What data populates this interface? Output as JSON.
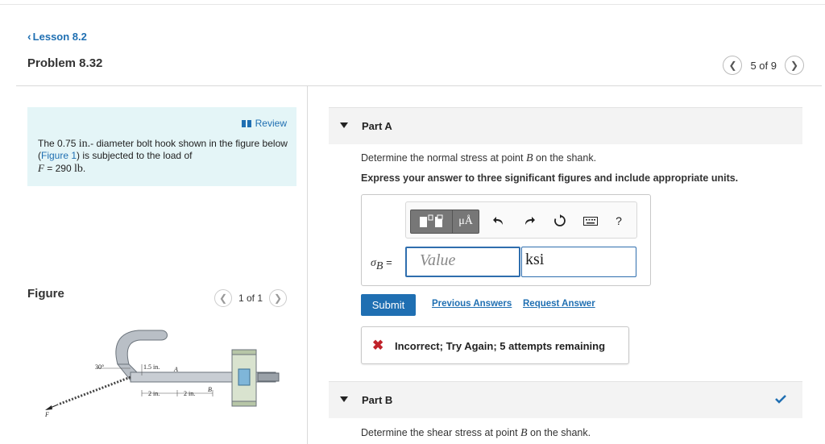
{
  "nav": {
    "lesson_link": "Lesson 8.2",
    "problem_title": "Problem 8.32",
    "page_indicator": "5 of 9"
  },
  "intro": {
    "review_label": "Review",
    "text_1": "The ",
    "diameter_value": "0.75",
    "diameter_unit": "in.",
    "text_2": "- diameter bolt hook shown in the figure below (",
    "figure_link": "Figure 1",
    "text_3": ") is subjected to the load of",
    "load_symbol": "F",
    "load_eq": " = 290 ",
    "load_unit": "lb",
    "load_end": "."
  },
  "figure": {
    "label": "Figure",
    "page_indicator": "1 of 1",
    "labels": {
      "angle": "30°",
      "height": "1.5 in.",
      "point_a": "A",
      "point_b": "B",
      "dim_1": "2 in.",
      "dim_2": "2 in.",
      "force": "F"
    }
  },
  "part_a": {
    "title": "Part A",
    "question_pre": "Determine the normal stress at point ",
    "question_point": "B",
    "question_post": " on the shank.",
    "instructions": "Express your answer to three significant figures and include appropriate units.",
    "toolbar": {
      "units_button": "μÅ",
      "help_label": "?"
    },
    "variable_symbol": "σ",
    "variable_sub": "B",
    "equals": " =",
    "value_placeholder": "Value",
    "units_value": "ksi",
    "submit_label": "Submit",
    "previous_answers": "Previous Answers",
    "request_answer": "Request Answer",
    "feedback": "Incorrect; Try Again; 5 attempts remaining"
  },
  "part_b": {
    "title": "Part B",
    "question_pre": "Determine the shear stress at point ",
    "question_point": "B",
    "question_post": " on the shank."
  },
  "colors": {
    "link": "#1f6fb2",
    "intro_bg": "#e4f5f7",
    "error": "#c0222a",
    "input_border": "#2f6eae"
  }
}
